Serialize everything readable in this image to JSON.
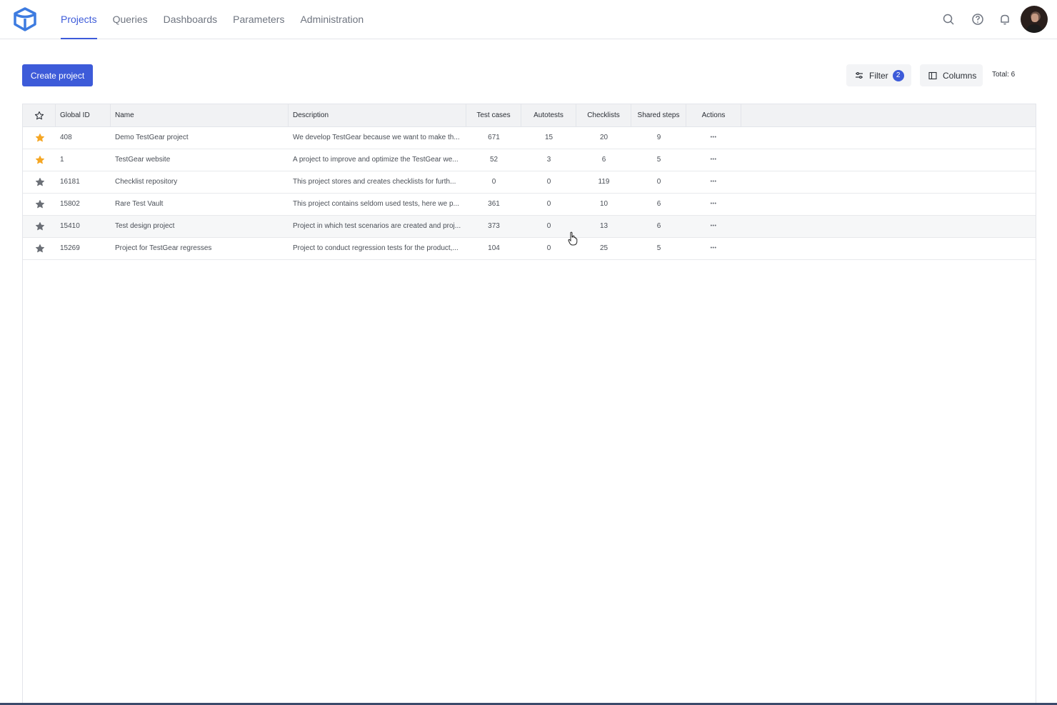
{
  "nav": {
    "items": [
      {
        "label": "Projects",
        "active": true
      },
      {
        "label": "Queries",
        "active": false
      },
      {
        "label": "Dashboards",
        "active": false
      },
      {
        "label": "Parameters",
        "active": false
      },
      {
        "label": "Administration",
        "active": false
      }
    ]
  },
  "header_icons": [
    "search-icon",
    "help-icon",
    "bell-icon"
  ],
  "toolbar": {
    "create_label": "Create project",
    "filter_label": "Filter",
    "filter_count": "2",
    "columns_label": "Columns",
    "total_label": "Total: 6"
  },
  "table": {
    "columns": [
      "Global ID",
      "Name",
      "Description",
      "Test cases",
      "Autotests",
      "Checklists",
      "Shared steps",
      "Actions"
    ],
    "rows": [
      {
        "favorite": true,
        "id": "408",
        "name": "Demo TestGear project",
        "description": "We develop TestGear because we want to make th...",
        "test_cases": "671",
        "autotests": "15",
        "checklists": "20",
        "shared_steps": "9"
      },
      {
        "favorite": true,
        "id": "1",
        "name": "TestGear website",
        "description": "A project to improve and optimize the TestGear we...",
        "test_cases": "52",
        "autotests": "3",
        "checklists": "6",
        "shared_steps": "5"
      },
      {
        "favorite": false,
        "id": "16181",
        "name": "Checklist repository",
        "description": "This project stores and creates checklists for furth...",
        "test_cases": "0",
        "autotests": "0",
        "checklists": "119",
        "shared_steps": "0"
      },
      {
        "favorite": false,
        "id": "15802",
        "name": "Rare Test Vault",
        "description": "This project contains seldom used tests, here we p...",
        "test_cases": "361",
        "autotests": "0",
        "checklists": "10",
        "shared_steps": "6"
      },
      {
        "favorite": false,
        "id": "15410",
        "name": "Test design project",
        "description": "Project in which test scenarios are created and proj...",
        "test_cases": "373",
        "autotests": "0",
        "checklists": "13",
        "shared_steps": "6"
      },
      {
        "favorite": false,
        "id": "15269",
        "name": "Project for TestGear regresses",
        "description": "Project to conduct regression tests for the product,...",
        "test_cases": "104",
        "autotests": "0",
        "checklists": "25",
        "shared_steps": "5"
      }
    ]
  },
  "colors": {
    "accent": "#3d5bd9",
    "star_favorite": "#f5a623",
    "star_default": "#6b6f76"
  }
}
